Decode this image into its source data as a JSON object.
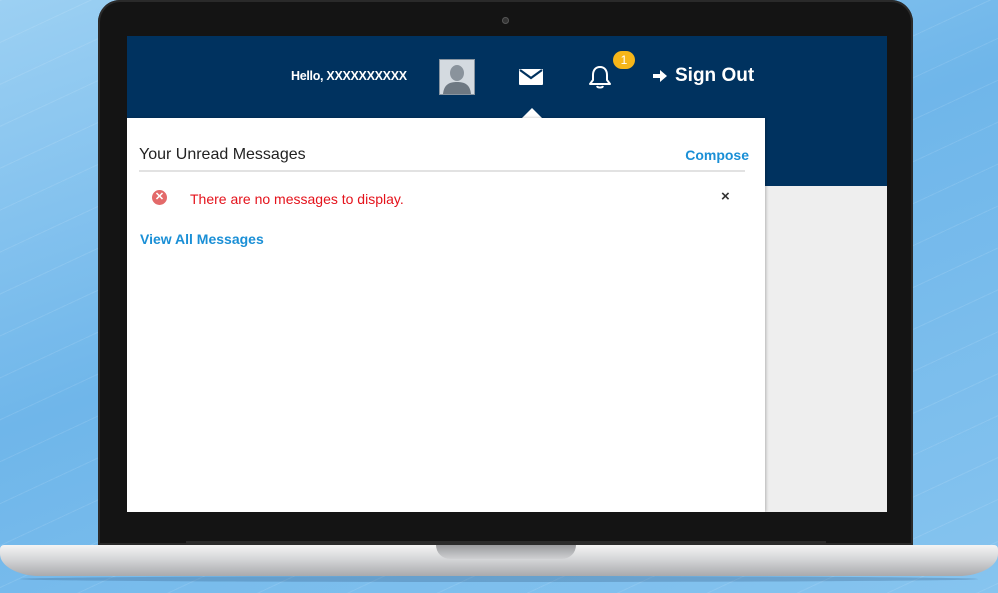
{
  "header": {
    "greeting": "Hello, XXXXXXXXXX",
    "notification_count": "1",
    "sign_out_label": "Sign Out",
    "icons": [
      "user-avatar",
      "envelope-icon",
      "bell-icon",
      "sign-out-icon"
    ]
  },
  "messages_panel": {
    "title": "Your Unread Messages",
    "compose_label": "Compose",
    "alert_text": "There are no messages to display.",
    "close_symbol": "×",
    "view_all_label": "View All Messages"
  },
  "colors": {
    "header_bg": "#00325f",
    "link": "#1a8fd6",
    "error_text": "#e4121b",
    "badge": "#f6b619"
  }
}
